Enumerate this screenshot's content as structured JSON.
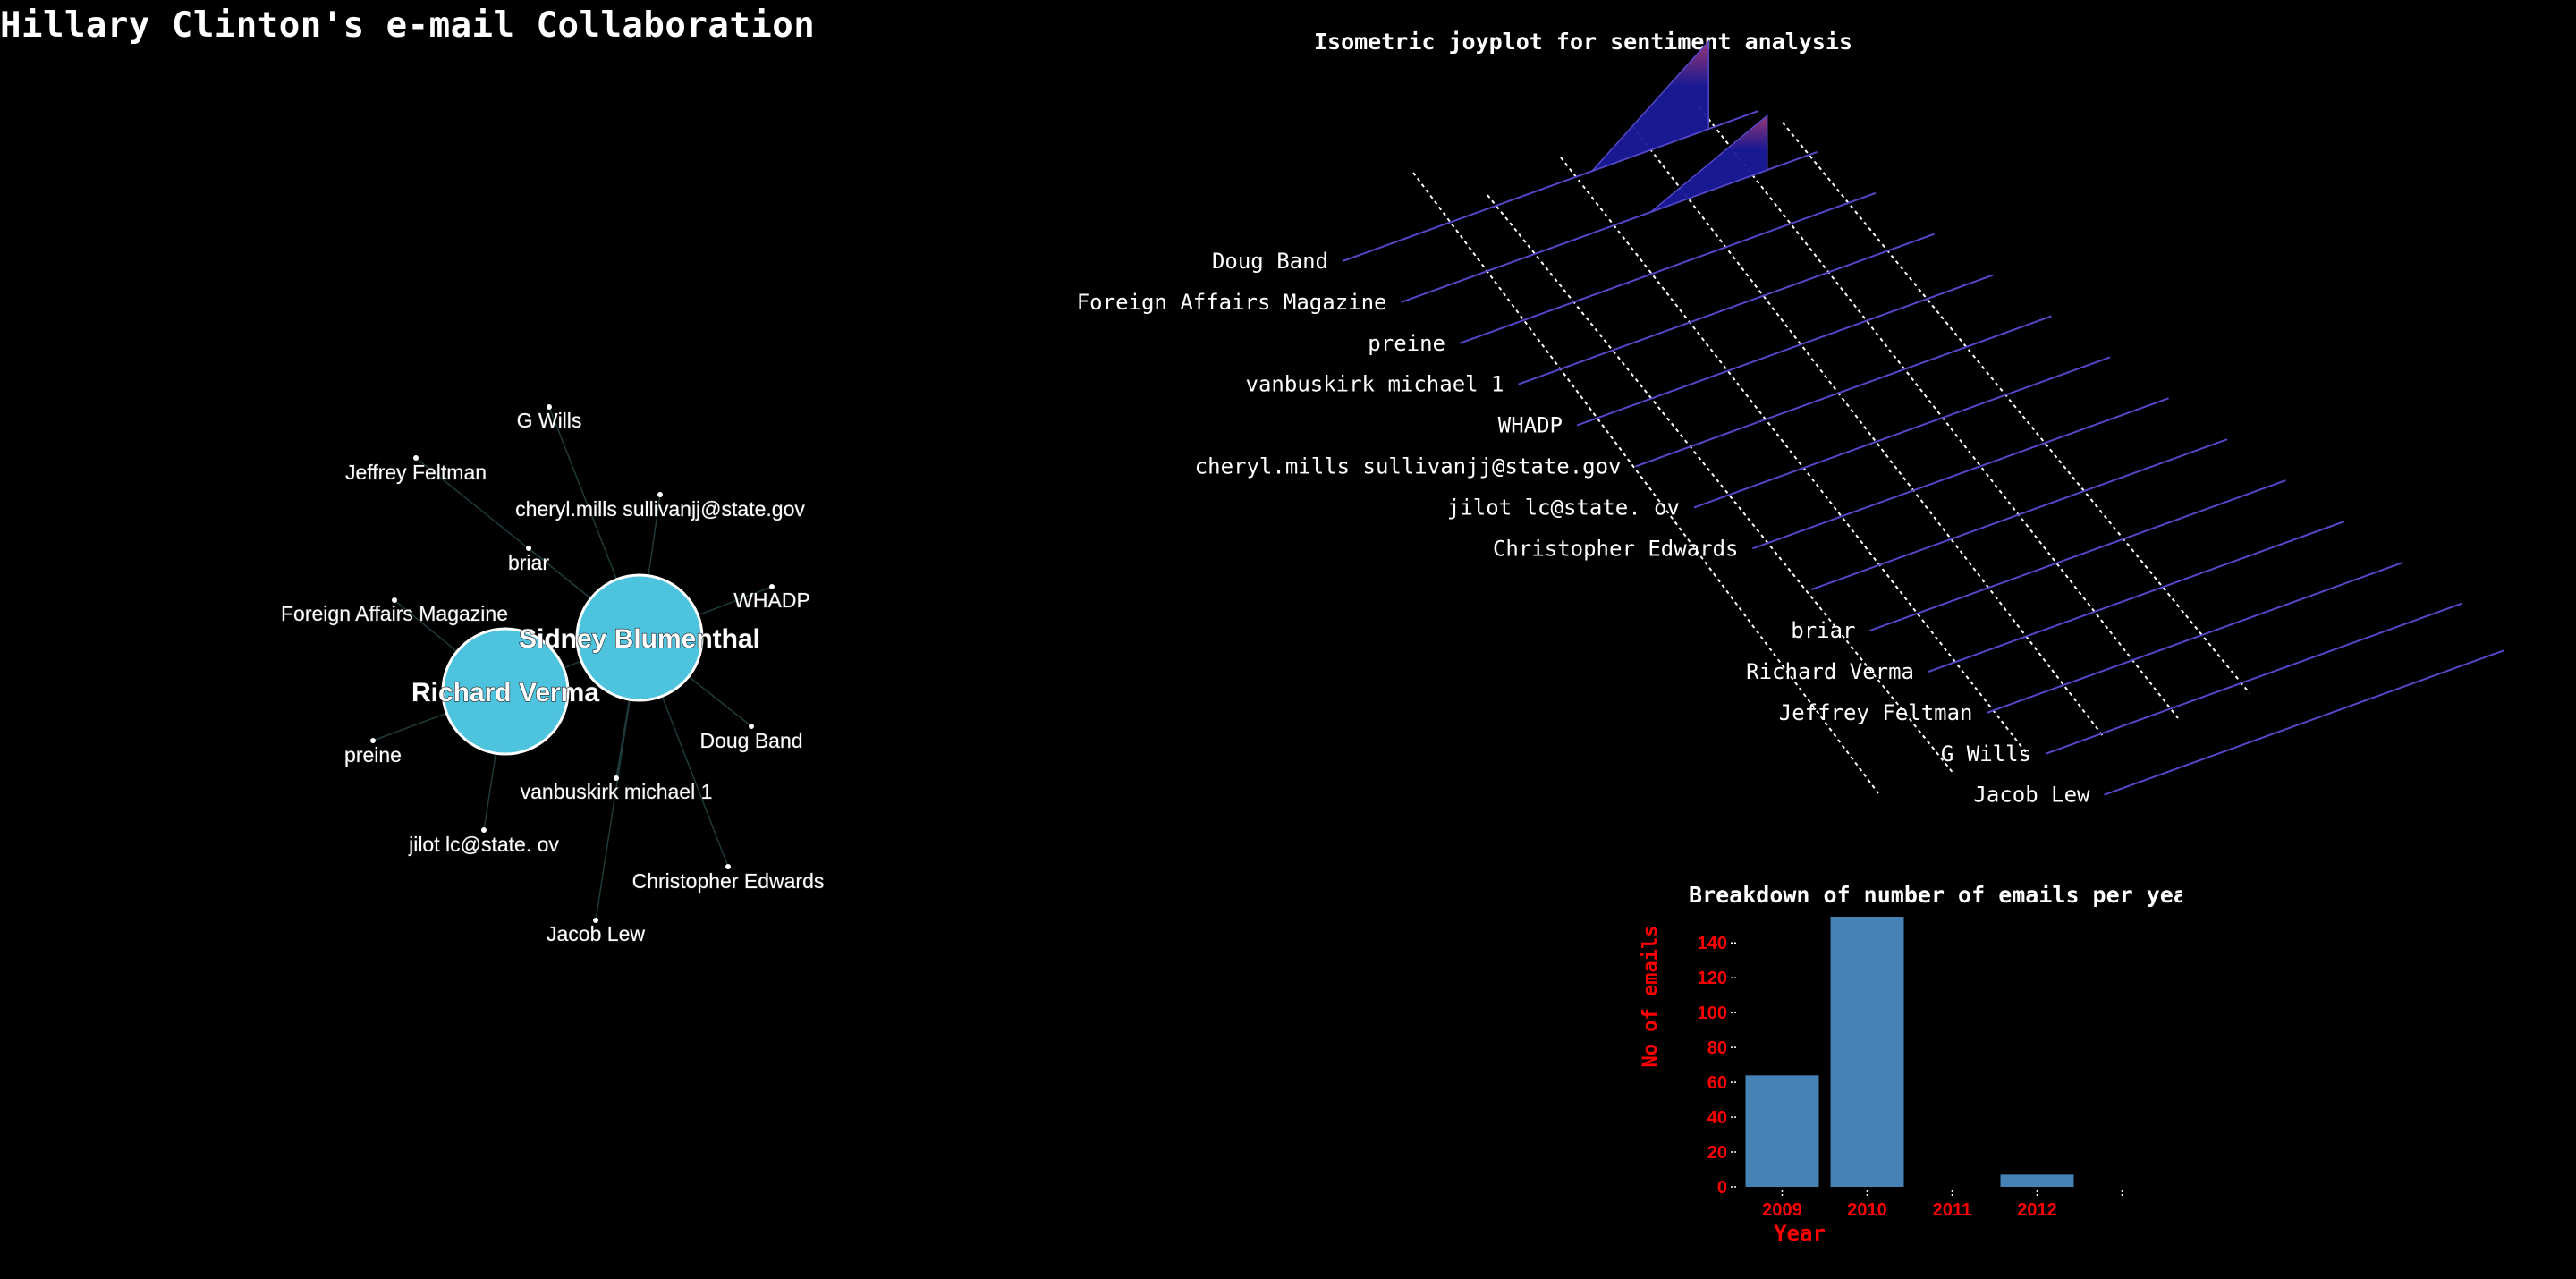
{
  "page": {
    "title": "Hillary Clinton's e-mail Collaboration"
  },
  "network": {
    "hubs": [
      {
        "id": "sidney",
        "label": "Sidney Blumenthal"
      },
      {
        "id": "richard",
        "label": "Richard Verma"
      }
    ],
    "nodes": [
      {
        "label": "G Wills",
        "hub": "sidney"
      },
      {
        "label": "Jeffrey Feltman",
        "hub": "sidney"
      },
      {
        "label": "cheryl.mills sullivanjj@state.gov",
        "hub": "sidney"
      },
      {
        "label": "briar",
        "hub": "sidney"
      },
      {
        "label": "WHADP",
        "hub": "sidney"
      },
      {
        "label": "Foreign Affairs Magazine",
        "hub": "richard"
      },
      {
        "label": "Doug Band",
        "hub": "sidney"
      },
      {
        "label": "preine",
        "hub": "richard"
      },
      {
        "label": "vanbuskirk michael 1",
        "hub": "sidney"
      },
      {
        "label": "jilot lc@state. ov",
        "hub": "richard"
      },
      {
        "label": "Christopher Edwards",
        "hub": "sidney"
      },
      {
        "label": "Jacob Lew",
        "hub": "sidney"
      }
    ],
    "colors": {
      "hub_fill": "#4ec3de",
      "hub_stroke": "#ffffff",
      "edge": "#1f3a3a",
      "node": "#ffffff"
    }
  },
  "joyplot": {
    "title": "Isometric joyplot for sentiment analysis",
    "rows": [
      "Doug Band",
      "Foreign Affairs Magazine",
      "preine",
      "vanbuskirk michael 1",
      "WHADP",
      "cheryl.mills sullivanjj@state.gov",
      "jilot lc@state. ov",
      "Christopher Edwards",
      "",
      "briar",
      "Richard Verma",
      "Jeffrey Feltman",
      "G Wills",
      "Jacob Lew"
    ],
    "peaks": [
      {
        "row": 0,
        "height": 1.0
      },
      {
        "row": 1,
        "height": 0.62
      }
    ],
    "colors": {
      "ridge": "#5548c8",
      "peak_fill": "#1a1a9a",
      "peak_top": "#a03a7a",
      "dashed": "#ffffff"
    }
  },
  "chart_data": {
    "type": "bar",
    "title": "Breakdown of number of emails per year",
    "xlabel": "Year",
    "ylabel": "No of emails",
    "categories": [
      "2009",
      "2010",
      "2011",
      "2012"
    ],
    "values": [
      64,
      155,
      0,
      7
    ],
    "ylim": [
      0,
      155
    ],
    "yticks": [
      0,
      20,
      40,
      60,
      80,
      100,
      120,
      140
    ],
    "bar_color": "#4682b4",
    "label_color": "#ff0000",
    "grid": false
  }
}
